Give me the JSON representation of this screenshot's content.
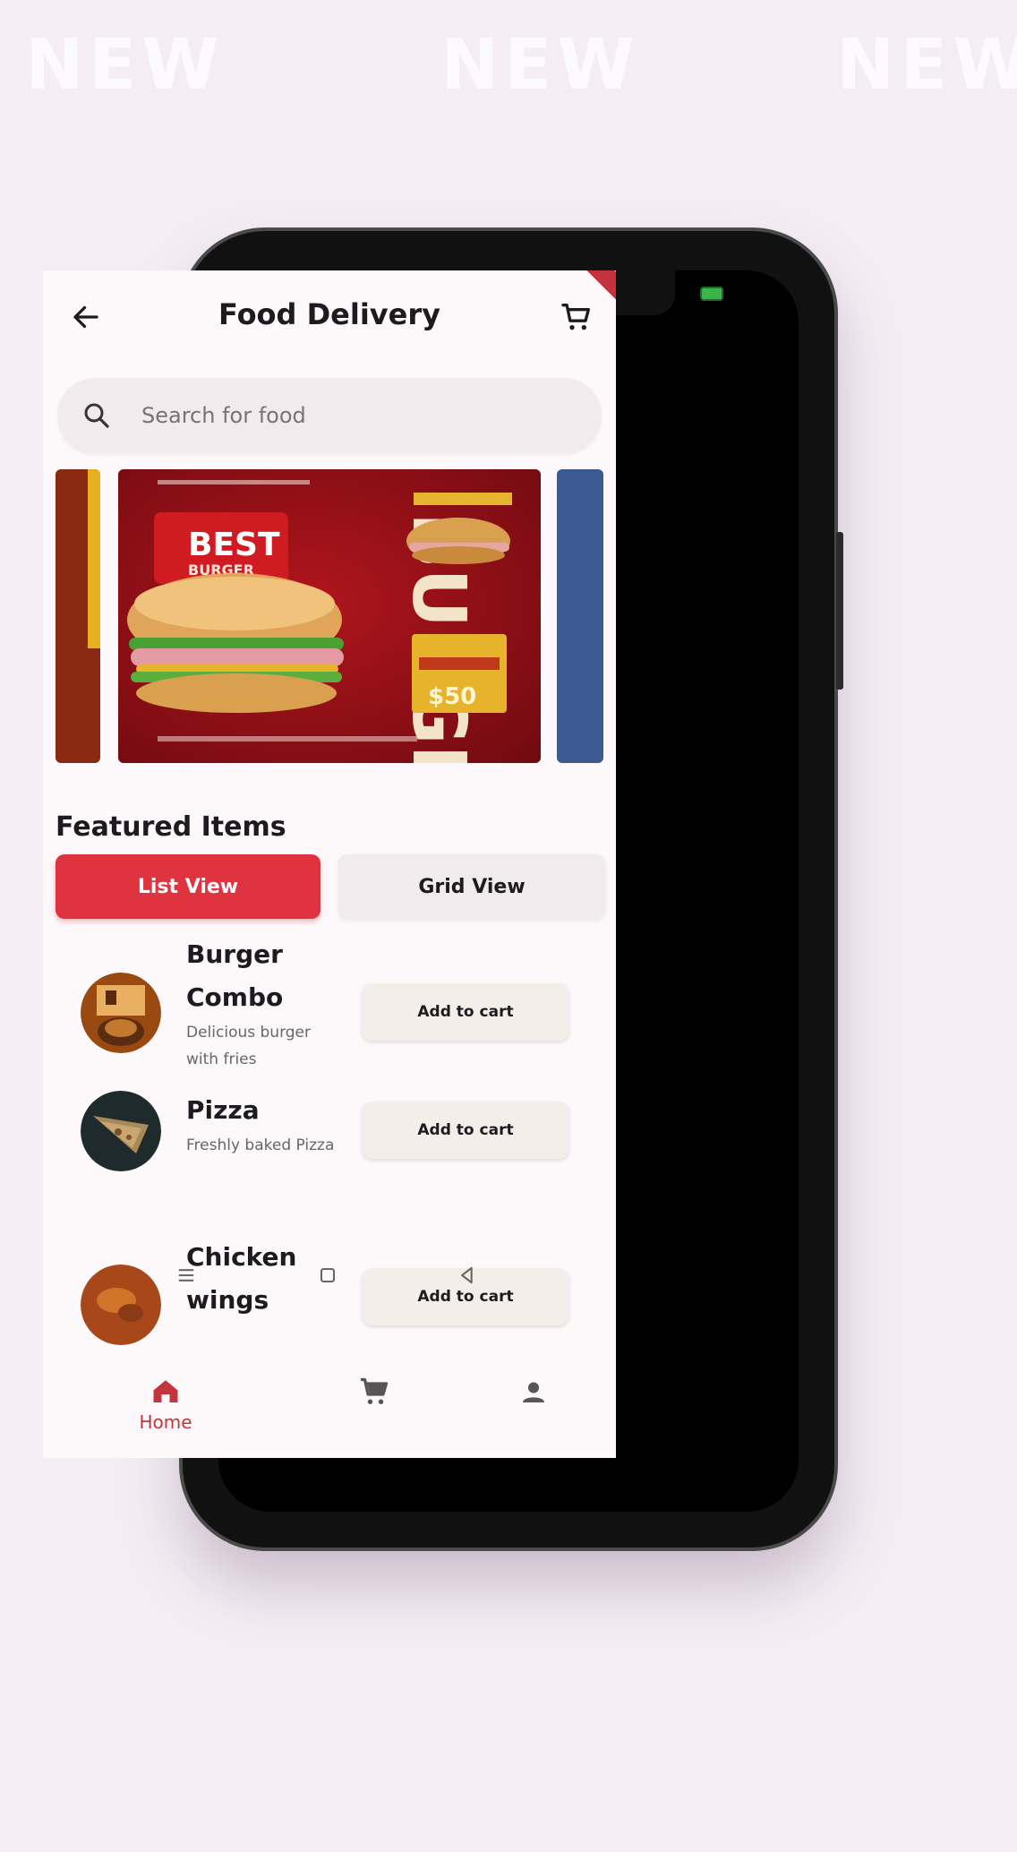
{
  "watermarks": [
    "NEW",
    "NEW",
    "NEW"
  ],
  "app": {
    "title": "Food Delivery"
  },
  "search": {
    "placeholder": "Search for food"
  },
  "banner": {
    "headline": "BEST",
    "subline": "BURGER",
    "big_word": "BURGER",
    "price": "$50"
  },
  "featured": {
    "title": "Featured Items",
    "list_view_label": "List View",
    "grid_view_label": "Grid View"
  },
  "food_items": [
    {
      "name": "Burger Combo",
      "description": "Delicious burger with fries",
      "button": "Add to cart"
    },
    {
      "name": "Pizza",
      "description": "Freshly baked Pizza",
      "button": "Add to cart"
    },
    {
      "name": "Chicken wings",
      "description": "",
      "button": "Add to cart"
    }
  ],
  "bottom_nav": {
    "home_label": "Home",
    "active": "home"
  },
  "colors": {
    "accent": "#e03340",
    "nav_active": "#c4343c",
    "background": "#f4eef4",
    "screen": "#fdf9fb"
  },
  "icons": [
    "back-arrow-icon",
    "cart-icon",
    "search-icon",
    "home-icon",
    "profile-icon",
    "menu-lines-icon",
    "square-home-icon",
    "triangle-back-icon"
  ]
}
